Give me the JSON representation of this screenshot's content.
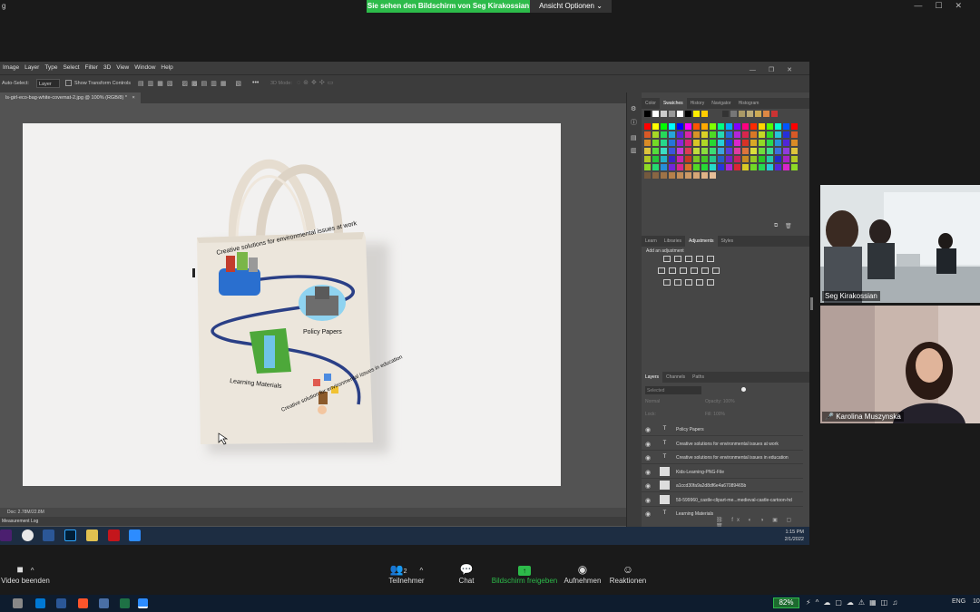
{
  "zoom": {
    "share_banner": "Sie sehen den Bildschirm von Seg Kirakossian",
    "view_options": "Ansicht Optionen",
    "window_corner_label": "g",
    "participants": [
      {
        "name": "Seg Kirakossian"
      },
      {
        "name": "Karolina Muszynska"
      }
    ],
    "toolbar": {
      "video": "Video beenden",
      "participants_label": "Teilnehmer",
      "participants_count": "2",
      "chat": "Chat",
      "share": "Bildschirm freigeben",
      "record": "Aufnehmen",
      "reactions": "Reaktionen"
    }
  },
  "photoshop": {
    "menu": [
      "Image",
      "Layer",
      "Type",
      "Select",
      "Filter",
      "3D",
      "View",
      "Window",
      "Help"
    ],
    "options": {
      "auto_select": "Auto-Select:",
      "auto_select_value": "Layer",
      "show_transform": "Show Transform Controls",
      "more": "•••",
      "mode3d": "3D Mode:"
    },
    "doc_tab": "ls-girl-eco-bag-white-covemat-2.jpg @ 100% (RGB/8) *",
    "status": "Doc: 2.78M/22.8M",
    "measurement_log": "Measurement Log",
    "bag_texts": {
      "top_arc": "Creative solutions for environmental issues at work",
      "policy": "Policy Papers",
      "learning": "Learning Materials",
      "bottom_arc": "Creative solution for environmental issues in education"
    },
    "swatch_tabs": [
      "Color",
      "Swatches",
      "History",
      "Navigator",
      "Histogram"
    ],
    "swatch_active": "Swatches",
    "adj_tabs": [
      "Learn",
      "Libraries",
      "Adjustments",
      "Styles"
    ],
    "adj_active": "Adjustments",
    "adj_title": "Add an adjustment",
    "layer_tabs": [
      "Layers",
      "Channels",
      "Paths"
    ],
    "layer_active": "Layers",
    "layer_search": "Selected",
    "blend": "Normal",
    "opacity": "Opacity:",
    "opacity_value": "100%",
    "lock": "Lock:",
    "fill": "Fill:",
    "fill_value": "100%",
    "layers": [
      {
        "type": "T",
        "name": "Policy Papers"
      },
      {
        "type": "T",
        "name": "Creative solutions for  environmental issues at work"
      },
      {
        "type": "T",
        "name": "Creative solutions for  environmental issues in education"
      },
      {
        "type": "img",
        "name": "Kids-Learning-PNG-File"
      },
      {
        "type": "img",
        "name": "a1ccd30fa9a2d8df6e4a67089465b"
      },
      {
        "type": "img",
        "name": "59-599960_castle-clipart-me...medieval-castle-cartoon-hd"
      },
      {
        "type": "T",
        "name": "Learning Materials"
      }
    ],
    "taskbar_time": "1:15 PM",
    "taskbar_date": "2/1/2022"
  },
  "windows": {
    "battery": "82%",
    "lang": "ENG",
    "clock": "10"
  },
  "colors": {
    "zoom_green": "#2dbb4a",
    "ps_bg": "#535353",
    "ps_panel": "#464646",
    "bag_arc": "#2a3f86"
  }
}
